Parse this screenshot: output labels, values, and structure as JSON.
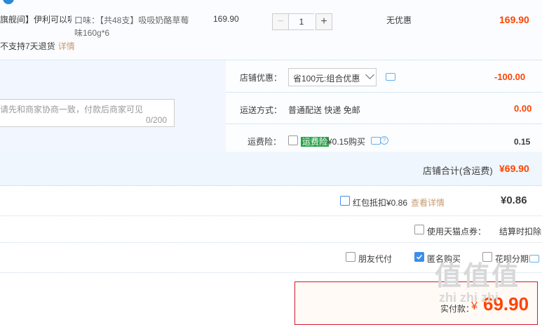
{
  "item": {
    "title": "旗舰间】伊利可以吸...",
    "sku_lines": [
      "口味：【共48支】吸吸奶酪草莓",
      "味160g*6"
    ],
    "price": "169.90",
    "quantity": "1",
    "minus": "−",
    "plus": "+",
    "discount": "无优惠",
    "total": "169.90",
    "return_note": "不支持7天退货",
    "return_link": "详情"
  },
  "message": {
    "placeholder": "请先和商家协商一致，付款后商家可见",
    "count": "0/200"
  },
  "shop": {
    "coupon_label": "店铺优惠：",
    "coupon_value": "省100元:组合优惠",
    "coupon_amount": "-100.00",
    "shipping_label": "运送方式：",
    "shipping_value": "普通配送 快递 免邮",
    "shipping_amount": "0.00",
    "insurance_label": "运费险：",
    "insurance_tag": "运费险",
    "insurance_text": "¥0.15购买",
    "insurance_amount": "0.15",
    "total_label": "店铺合计(含运费)",
    "total_amount": "¥69.90"
  },
  "redpacket": {
    "label": "红包抵扣¥0.86",
    "link": "查看详情",
    "amount": "¥0.86"
  },
  "points": {
    "label": "使用天猫点券：",
    "note": "结算时扣除"
  },
  "options": {
    "friend": "朋友代付",
    "anonymous": "匿名购买",
    "huabei": "花呗分期"
  },
  "pay": {
    "label": "实付款：",
    "currency": "¥",
    "amount": "69.90"
  },
  "watermark": {
    "text": "值 值 值",
    "site": "zhi zhi zhi"
  },
  "colors": {
    "accent": "#ff4400",
    "brand_blue": "#3d8eea",
    "insurance_green": "#2ba149"
  }
}
